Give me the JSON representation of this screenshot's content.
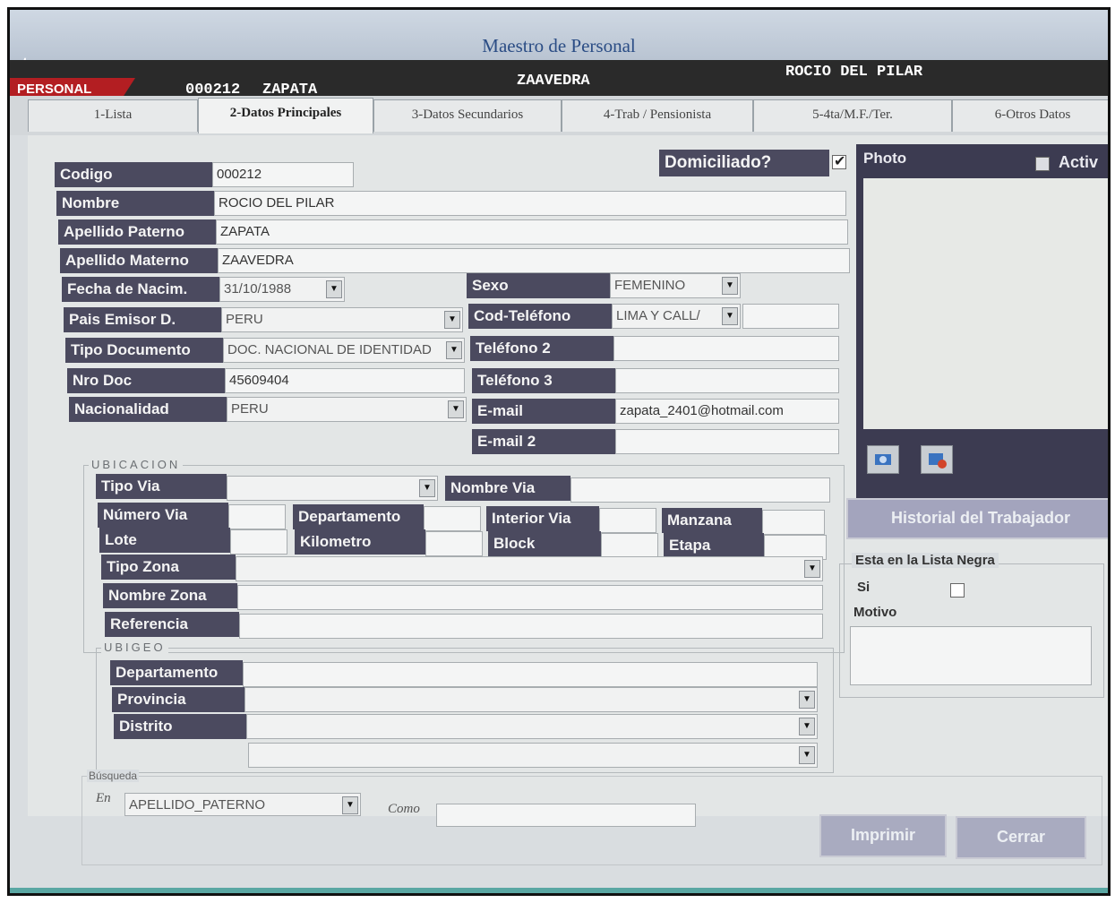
{
  "window": {
    "title": "Maestro de Personal",
    "app_icon": "ct"
  },
  "header": {
    "badge": "PERSONAL",
    "code": "000212",
    "apellido_paterno": "ZAPATA",
    "apellido_materno": "ZAAVEDRA",
    "nombres": "ROCIO DEL PILAR"
  },
  "tabs": [
    {
      "label": "1-Lista"
    },
    {
      "label": "2-Datos Principales"
    },
    {
      "label": "3-Datos Secundarios"
    },
    {
      "label": "4-Trab / Pensionista"
    },
    {
      "label": "5-4ta/M.F./Ter."
    },
    {
      "label": "6-Otros Datos"
    }
  ],
  "form": {
    "domiciliado_label": "Domiciliado?",
    "codigo": {
      "label": "Codigo",
      "value": "000212"
    },
    "nombre": {
      "label": "Nombre",
      "value": "ROCIO DEL PILAR"
    },
    "apellido_paterno": {
      "label": "Apellido Paterno",
      "value": "ZAPATA"
    },
    "apellido_materno": {
      "label": "Apellido Materno",
      "value": "ZAAVEDRA"
    },
    "fecha_nacim": {
      "label": "Fecha de Nacim.",
      "value": "31/10/1988"
    },
    "pais_emisor": {
      "label": "Pais Emisor D.",
      "value": "PERU"
    },
    "tipo_documento": {
      "label": "Tipo Documento",
      "value": "DOC. NACIONAL DE IDENTIDAD"
    },
    "nro_doc": {
      "label": "Nro Doc",
      "value": "45609404"
    },
    "nacionalidad": {
      "label": "Nacionalidad",
      "value": "PERU"
    },
    "sexo": {
      "label": "Sexo",
      "value": "FEMENINO"
    },
    "cod_telefono": {
      "label": "Cod-Teléfono",
      "value": "LIMA Y CALL/"
    },
    "telefono2": {
      "label": "Teléfono 2",
      "value": ""
    },
    "telefono3": {
      "label": "Teléfono 3",
      "value": ""
    },
    "email": {
      "label": "E-mail",
      "value": "zapata_2401@hotmail.com"
    },
    "email2": {
      "label": "E-mail 2",
      "value": ""
    }
  },
  "ubicacion": {
    "title": "UBICACION",
    "tipo_via": "Tipo Via",
    "nombre_via": "Nombre Via",
    "numero_via": "Número Via",
    "departamento": "Departamento",
    "interior_via": "Interior Via",
    "manzana": "Manzana",
    "lote": "Lote",
    "kilometro": "Kilometro",
    "block": "Block",
    "etapa": "Etapa",
    "tipo_zona": "Tipo Zona",
    "nombre_zona": "Nombre Zona",
    "referencia": "Referencia"
  },
  "ubigeo": {
    "title": "UBIGEO",
    "departamento": "Departamento",
    "provincia": "Provincia",
    "distrito": "Distrito"
  },
  "busqueda": {
    "title": "Búsqueda",
    "en_label": "En",
    "en_value": "APELLIDO_PATERNO",
    "como_label": "Como",
    "como_value": ""
  },
  "side": {
    "photo_label": "Photo",
    "activo_label": "Activ",
    "historial_label": "Historial del Trabajador",
    "lista_negra_title": "Esta en la Lista Negra",
    "si_label": "Si",
    "motivo_label": "Motivo"
  },
  "buttons": {
    "imprimir": "Imprimir",
    "cerrar": "Cerrar"
  },
  "icons": {
    "app": "app-icon",
    "photo_load": "camera-icon",
    "photo_clear": "image-delete-icon"
  }
}
